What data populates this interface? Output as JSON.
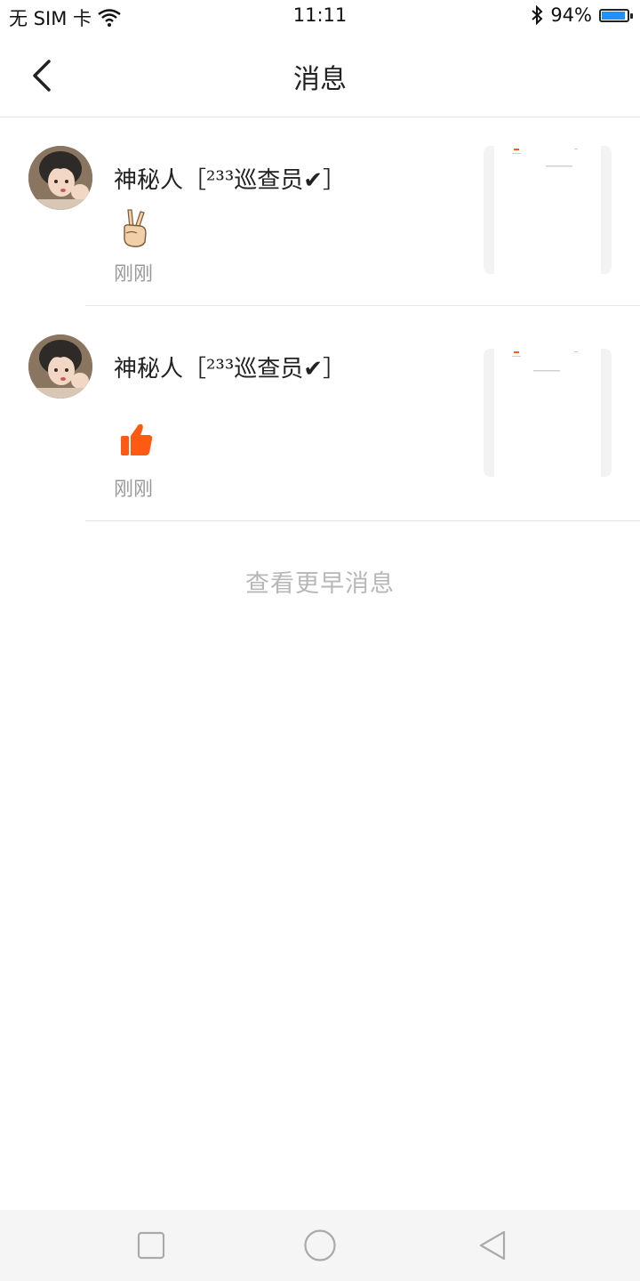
{
  "status_bar": {
    "carrier": "无 SIM 卡",
    "time": "11:11",
    "battery_percent": "94%",
    "battery_level": 0.94,
    "icons": [
      "wifi-icon",
      "bluetooth-icon",
      "battery-icon"
    ]
  },
  "header": {
    "title": "消息",
    "back_icon": "chevron-left-icon"
  },
  "messages": [
    {
      "username": "神秘人［²³³巡查员✔］",
      "reaction_icon": "victory-hand-icon",
      "time": "刚刚"
    },
    {
      "username": "神秘人［²³³巡查员✔］",
      "reaction_icon": "thumbs-up-icon",
      "time": "刚刚"
    }
  ],
  "more_label": "查看更早消息",
  "nav_bar": {
    "buttons": [
      "recent-apps-icon",
      "home-icon",
      "back-triangle-icon"
    ]
  },
  "colors": {
    "accent": "#ff5a14",
    "battery": "#1e90ff",
    "muted_text": "#9a9a9a",
    "divider": "#e6e6e6"
  }
}
